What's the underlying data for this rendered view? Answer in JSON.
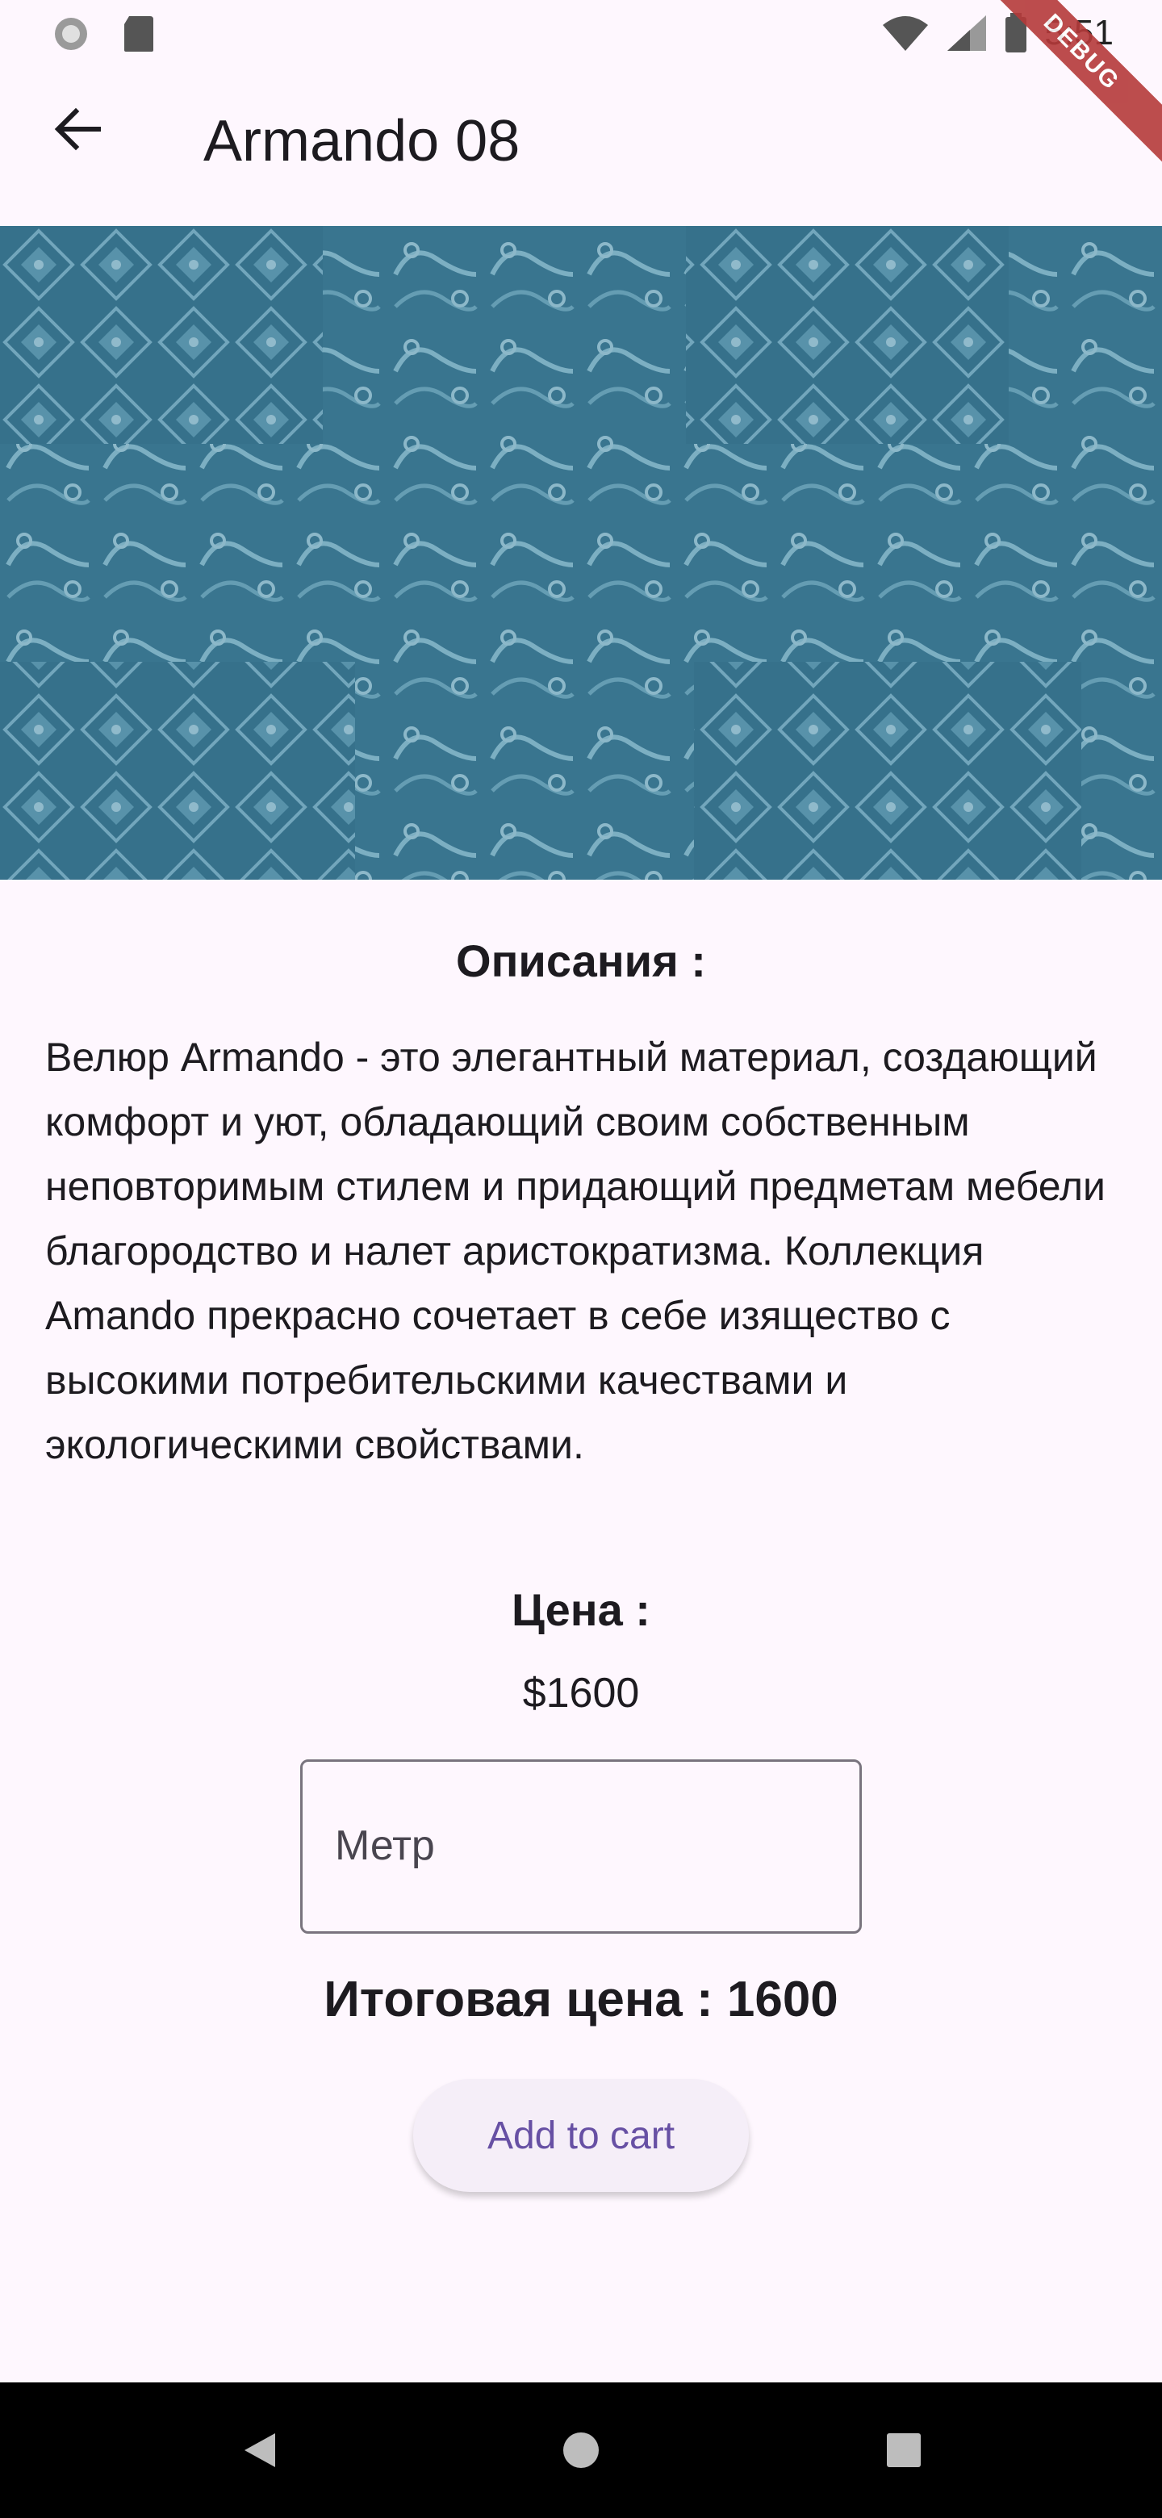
{
  "statusbar": {
    "time": "5:51",
    "debug_label": "DEBUG"
  },
  "appbar": {
    "title": "Armando 08",
    "back_icon": "arrow-left-icon"
  },
  "hero": {
    "image_name": "fabric-pattern-image",
    "color": "#3f7891"
  },
  "description": {
    "title": "Описания :",
    "text": "Велюр Armando - это элегантный материал, создающий комфорт и уют, обладающий своим собственным неповторимым стилем и придающий предметам мебели благородство и налет аристократизма. Коллекция Amando прекрасно сочетает в себе изящество с высокими потребительскими качествами и экологическими свойствами."
  },
  "price": {
    "title": "Цена :",
    "value": "$1600"
  },
  "meter_field": {
    "placeholder": "Метр"
  },
  "total": {
    "label": "Итоговая цена : 1600"
  },
  "cart_button": {
    "label": "Add to cart"
  },
  "colors": {
    "accent": "#6750a4",
    "background": "#fef7fe"
  }
}
